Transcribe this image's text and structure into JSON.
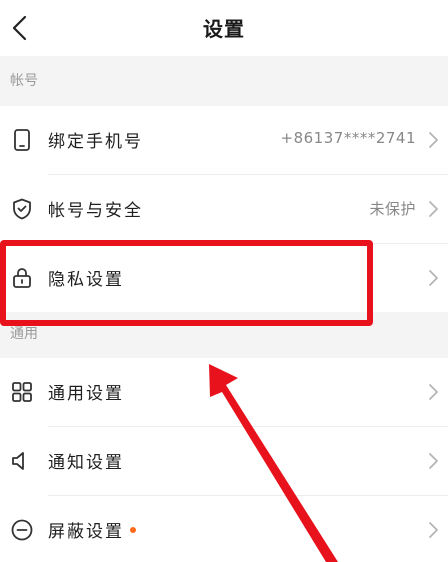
{
  "header": {
    "title": "设置",
    "back_icon": "chevron-left-icon"
  },
  "sections": {
    "account": "帐号",
    "general": "通用"
  },
  "rows": {
    "phone": {
      "label": "绑定手机号",
      "value": "+86137****2741",
      "icon": "phone-icon"
    },
    "security": {
      "label": "帐号与安全",
      "value": "未保护",
      "icon": "shield-check-icon"
    },
    "privacy": {
      "label": "隐私设置",
      "icon": "lock-icon"
    },
    "general": {
      "label": "通用设置",
      "icon": "grid-icon"
    },
    "notify": {
      "label": "通知设置",
      "icon": "speaker-icon"
    },
    "block": {
      "label": "屏蔽设置",
      "icon": "minus-circle-icon",
      "badge_color": "#ff6a1a"
    }
  },
  "annotation": {
    "box_color": "#e8121c",
    "arrow_color": "#e8121c"
  }
}
